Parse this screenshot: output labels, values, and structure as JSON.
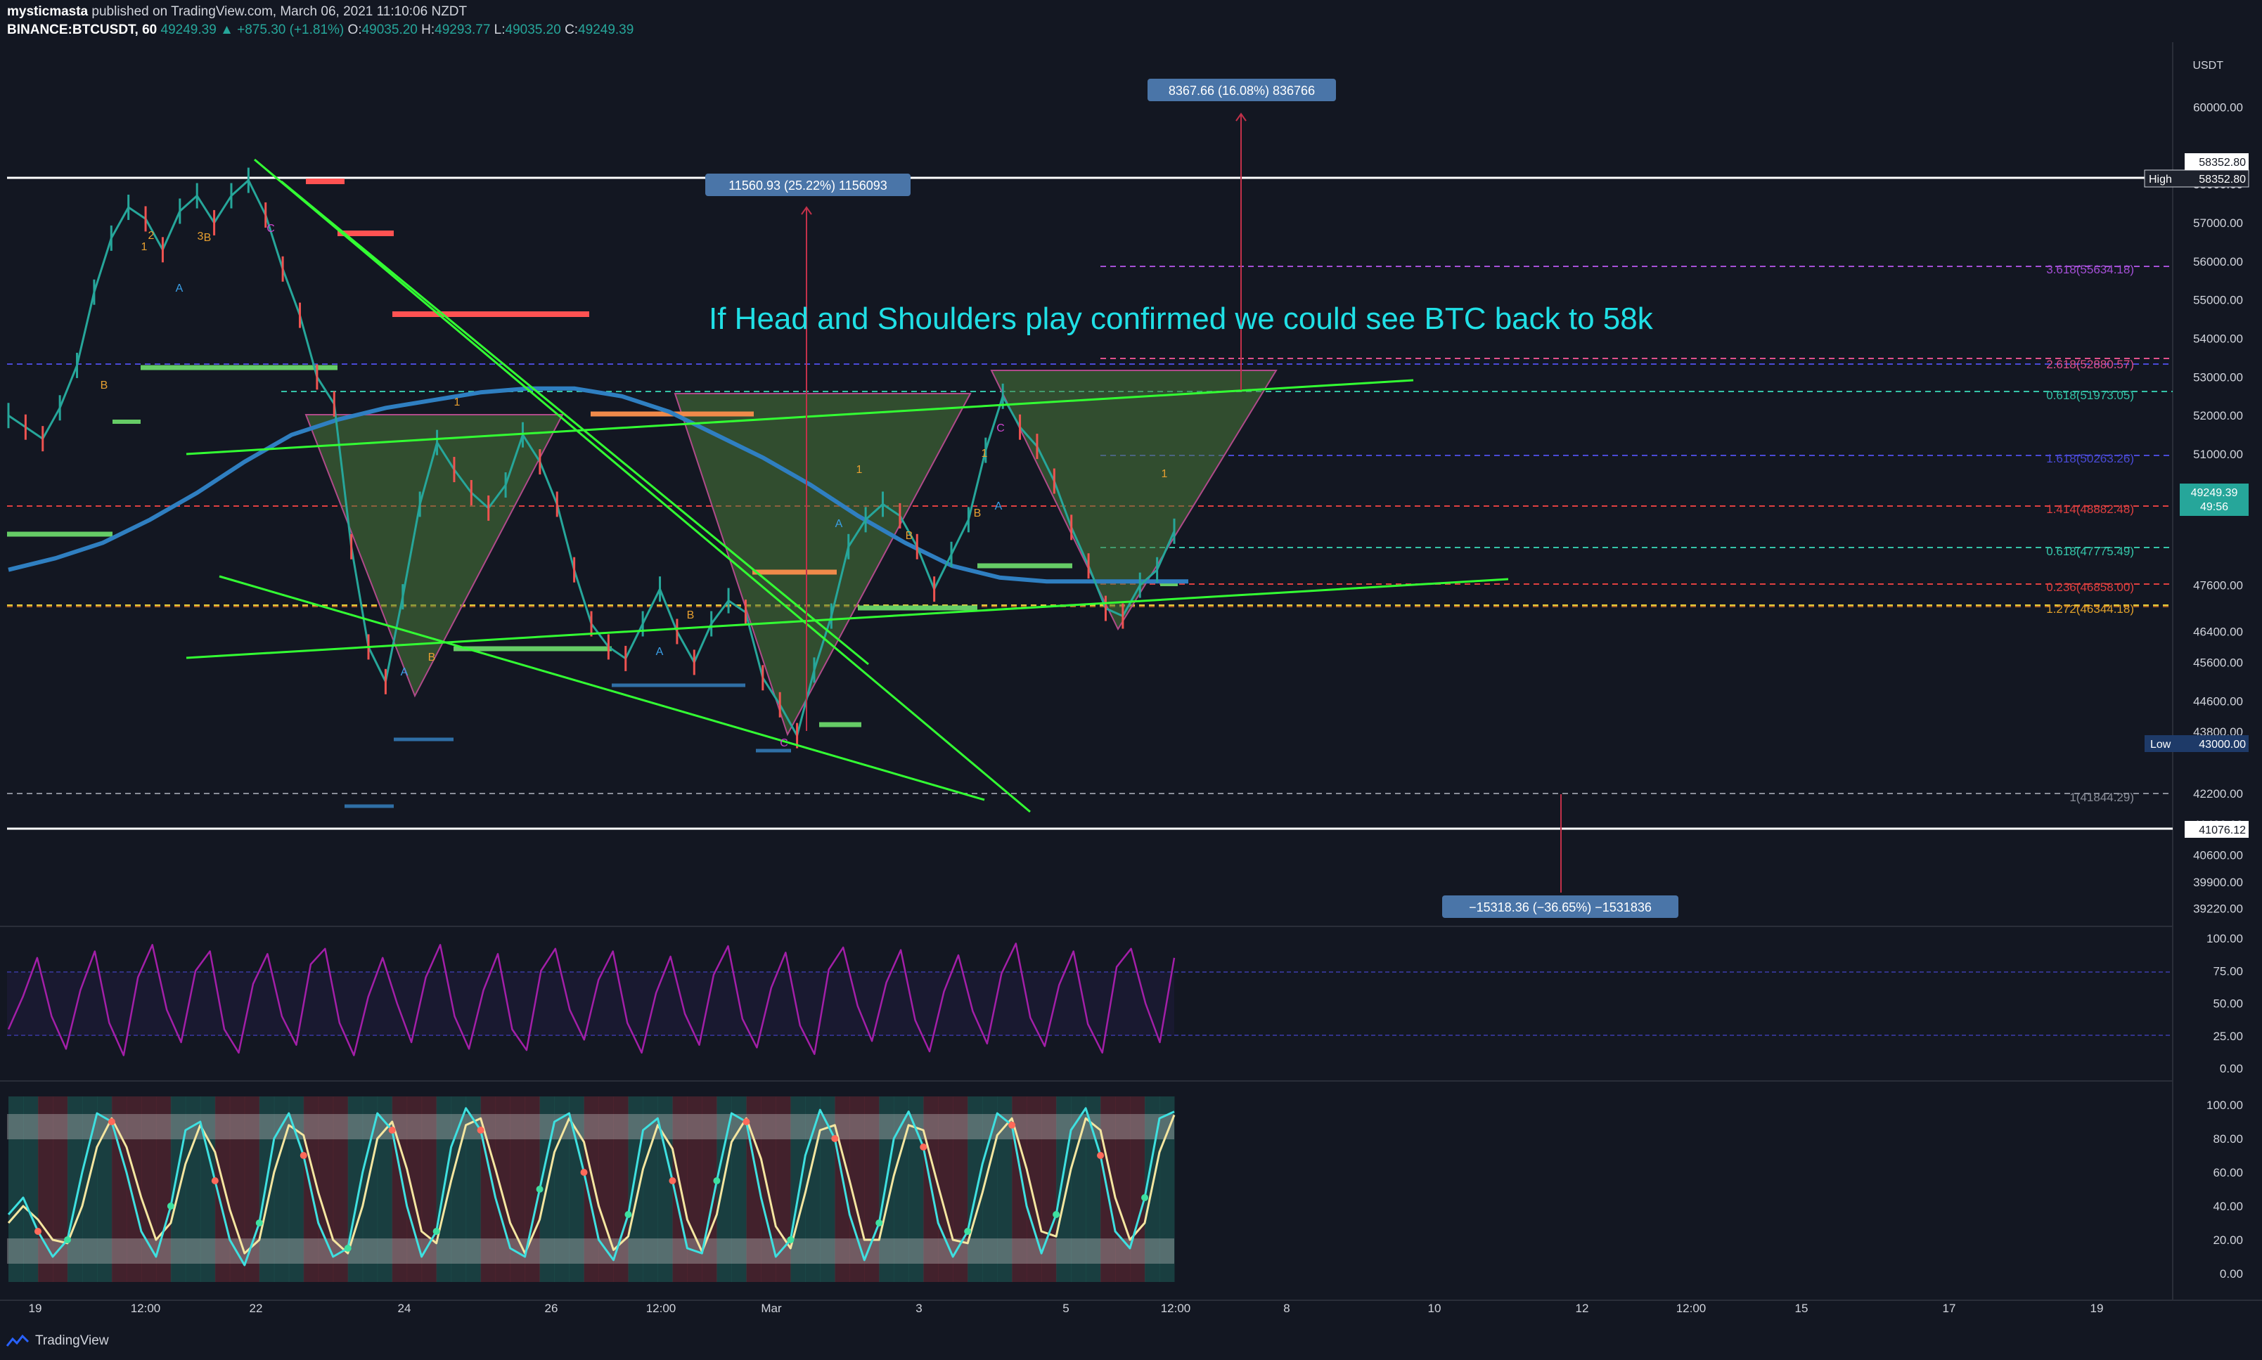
{
  "header": {
    "author": "mysticmasta",
    "published": "published on TradingView.com, March 06, 2021 11:10:06 NZDT",
    "symbol": "BINANCE:BTCUSDT, 60",
    "last": "49249.39",
    "change": "▲ +875.30 (+1.81%)",
    "o_label": "O:",
    "o": "49035.20",
    "h_label": "H:",
    "h": "49293.77",
    "l_label": "L:",
    "l": "49035.20",
    "c_label": "C:",
    "c": "49249.39"
  },
  "footer": {
    "brand": "TradingView"
  },
  "colors": {
    "background": "#131722",
    "up": "#26a69a",
    "down": "#ef5350",
    "trend": "#33ff33",
    "annotation": "#20e0e6",
    "ma": "#2f7fc1"
  },
  "annotation": "If Head and Shoulders play confirmed we could see BTC back to 58k",
  "chart_data": [
    {
      "type": "line",
      "panel": "price",
      "currency": "USDT",
      "ylim": [
        38900,
        61500
      ],
      "x_ticks": [
        "19",
        "12:00",
        "22",
        "24",
        "26",
        "12:00",
        "Mar",
        "3",
        "5",
        "12:00",
        "8",
        "10",
        "12",
        "12:00",
        "15",
        "17",
        "19"
      ],
      "y_ticks": [
        "60000.00",
        "58000.00",
        "57000.00",
        "56000.00",
        "55000.00",
        "54000.00",
        "53000.00",
        "52000.00",
        "51000.00",
        "50000.00",
        "47600.00",
        "46400.00",
        "45600.00",
        "44600.00",
        "43800.00",
        "42200.00",
        "41400.00",
        "40600.00",
        "39900.00",
        "39220.00"
      ],
      "price_path": [
        52000,
        51700,
        51400,
        52200,
        53300,
        55200,
        56600,
        57400,
        57100,
        56300,
        57300,
        57700,
        57000,
        57700,
        58100,
        57200,
        55800,
        54600,
        53000,
        52300,
        48600,
        46000,
        45100,
        47300,
        49700,
        51300,
        50600,
        50000,
        49600,
        50200,
        51500,
        50800,
        49700,
        48000,
        46600,
        46000,
        45700,
        46600,
        47500,
        46400,
        45600,
        46600,
        47200,
        46900,
        45200,
        44500,
        43700,
        45400,
        46800,
        48600,
        49300,
        49700,
        49400,
        48600,
        47500,
        48400,
        49300,
        51100,
        52500,
        51700,
        51200,
        50300,
        49100,
        48100,
        47000,
        46800,
        47600,
        48000,
        49000
      ],
      "moving_average": [
        48000,
        48300,
        48700,
        49300,
        50000,
        50800,
        51500,
        51900,
        52200,
        52400,
        52600,
        52700,
        52700,
        52500,
        52100,
        51500,
        50900,
        50200,
        49400,
        48700,
        48100,
        47800,
        47700,
        47700,
        47700,
        47700
      ],
      "levels": [
        {
          "label": "High",
          "value": "58352.80"
        },
        {
          "label": "",
          "value": "58352.80"
        },
        {
          "label": "Low",
          "value": "43000.00"
        },
        {
          "label": "",
          "value": "41076.12"
        }
      ],
      "fib_labels": [
        "3.618(55634.18)",
        "2.618(52880.57)",
        "0.618(51973.05)",
        "1.618(50263.26)",
        "1.414(48882.48)",
        "0.618(47775.49)",
        "0.236(46858.00)",
        "1.272(46344.18)",
        "1(41844.29)"
      ],
      "last_price": "49249.39",
      "countdown": "49:56",
      "measure_labels": [
        "11560.93 (25.22%) 1156093",
        "8367.66 (16.08%) 836766",
        "−15318.36 (−36.65%) −1531836"
      ],
      "wave_labels": [
        "1",
        "2",
        "3",
        "A",
        "B",
        "C",
        "B",
        "1",
        "A",
        "B",
        "A",
        "B",
        "C",
        "1",
        "A",
        "B",
        "1",
        "A",
        "B",
        "C",
        "1"
      ]
    },
    {
      "type": "line",
      "panel": "oscillator",
      "ylim": [
        0,
        100
      ],
      "y_ticks": [
        "100.00",
        "75.00",
        "50.00",
        "25.00",
        "0.00"
      ],
      "values": [
        30,
        55,
        85,
        40,
        15,
        60,
        90,
        35,
        10,
        70,
        95,
        45,
        20,
        75,
        90,
        30,
        12,
        65,
        88,
        40,
        18,
        80,
        92,
        35,
        10,
        55,
        85,
        50,
        20,
        70,
        95,
        40,
        15,
        60,
        88,
        30,
        14,
        75,
        92,
        45,
        22,
        68,
        90,
        35,
        12,
        58,
        86,
        42,
        18,
        72,
        94,
        38,
        16,
        62,
        89,
        33,
        11,
        76,
        93,
        48,
        21,
        66,
        91,
        37,
        13,
        59,
        87,
        44,
        19,
        73,
        96,
        39,
        17,
        64,
        90,
        34,
        12,
        78,
        92,
        50,
        20,
        85
      ]
    },
    {
      "type": "line",
      "panel": "stochastic",
      "ylim": [
        0,
        100
      ],
      "y_ticks": [
        "100.00",
        "80.00",
        "60.00",
        "40.00",
        "20.00",
        "0.00"
      ],
      "k": [
        35,
        45,
        25,
        10,
        20,
        60,
        95,
        90,
        60,
        25,
        10,
        40,
        85,
        90,
        55,
        20,
        5,
        30,
        80,
        95,
        70,
        30,
        10,
        15,
        60,
        95,
        85,
        40,
        10,
        25,
        75,
        98,
        85,
        45,
        15,
        10,
        50,
        90,
        95,
        60,
        20,
        8,
        35,
        85,
        92,
        55,
        15,
        12,
        55,
        95,
        90,
        45,
        10,
        20,
        70,
        97,
        80,
        35,
        8,
        30,
        80,
        96,
        75,
        30,
        10,
        25,
        65,
        95,
        88,
        40,
        12,
        35,
        85,
        98,
        70,
        25,
        15,
        45,
        92,
        96
      ],
      "d": [
        30,
        40,
        32,
        20,
        18,
        40,
        75,
        92,
        75,
        45,
        20,
        30,
        65,
        88,
        72,
        38,
        12,
        20,
        60,
        88,
        82,
        48,
        20,
        12,
        40,
        80,
        90,
        62,
        25,
        18,
        55,
        88,
        92,
        62,
        30,
        12,
        32,
        72,
        92,
        78,
        40,
        14,
        22,
        62,
        88,
        74,
        32,
        13,
        35,
        78,
        92,
        68,
        28,
        15,
        48,
        85,
        88,
        55,
        20,
        20,
        58,
        88,
        85,
        52,
        20,
        18,
        48,
        82,
        92,
        62,
        25,
        22,
        62,
        92,
        85,
        45,
        20,
        30,
        72,
        94
      ]
    }
  ]
}
